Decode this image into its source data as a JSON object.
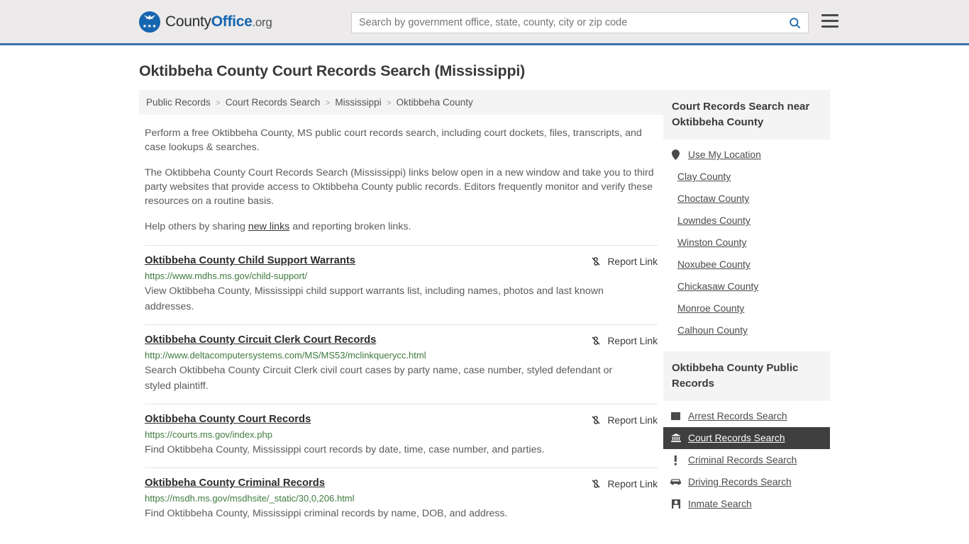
{
  "header": {
    "logo_text_1": "County",
    "logo_text_2": "Office",
    "logo_text_3": ".org",
    "logo_stars": "★★★",
    "search_placeholder": "Search by government office, state, county, city or zip code",
    "search_value": "",
    "search_icon": "search-icon",
    "menu_icon": "hamburger-menu-icon",
    "accent_color": "#3b72a8",
    "logo_blue": "#1565b0"
  },
  "page": {
    "title": "Oktibbeha County Court Records Search (Mississippi)"
  },
  "breadcrumb": {
    "separator": ">",
    "items": [
      {
        "label": "Public Records"
      },
      {
        "label": "Court Records Search"
      },
      {
        "label": "Mississippi"
      },
      {
        "label": "Oktibbeha County"
      }
    ]
  },
  "intro": {
    "p1": "Perform a free Oktibbeha County, MS public court records search, including court dockets, files, transcripts, and case lookups & searches.",
    "p2": "The Oktibbeha County Court Records Search (Mississippi) links below open in a new window and take you to third party websites that provide access to Oktibbeha County public records. Editors frequently monitor and verify these resources on a routine basis.",
    "p3_before": "Help others by sharing ",
    "p3_link": "new links",
    "p3_after": " and reporting broken links."
  },
  "results": {
    "report_label": "Report Link",
    "report_icon": "broken-link-icon",
    "items": [
      {
        "title": "Oktibbeha County Child Support Warrants",
        "url": "https://www.mdhs.ms.gov/child-support/",
        "description": "View Oktibbeha County, Mississippi child support warrants list, including names, photos and last known addresses."
      },
      {
        "title": "Oktibbeha County Circuit Clerk Court Records",
        "url": "http://www.deltacomputersystems.com/MS/MS53/mclinkquerycc.html",
        "description": "Search Oktibbeha County Circuit Clerk civil court cases by party name, case number, styled defendant or styled plaintiff."
      },
      {
        "title": "Oktibbeha County Court Records",
        "url": "https://courts.ms.gov/index.php",
        "description": "Find Oktibbeha County, Mississippi court records by date, time, case number, and parties."
      },
      {
        "title": "Oktibbeha County Criminal Records",
        "url": "https://msdh.ms.gov/msdhsite/_static/30,0,206.html",
        "description": "Find Oktibbeha County, Mississippi criminal records by name, DOB, and address."
      }
    ]
  },
  "sidebar": {
    "nearby": {
      "heading": "Court Records Search near Oktibbeha County",
      "items": [
        {
          "label": "Use My Location",
          "icon": "map-pin-icon"
        },
        {
          "label": "Clay County",
          "icon": ""
        },
        {
          "label": "Choctaw County",
          "icon": ""
        },
        {
          "label": "Lowndes County",
          "icon": ""
        },
        {
          "label": "Winston County",
          "icon": ""
        },
        {
          "label": "Noxubee County",
          "icon": ""
        },
        {
          "label": "Chickasaw County",
          "icon": ""
        },
        {
          "label": "Monroe County",
          "icon": ""
        },
        {
          "label": "Calhoun County",
          "icon": ""
        }
      ]
    },
    "public_records": {
      "heading": "Oktibbeha County Public Records",
      "active_index": 1,
      "items": [
        {
          "label": "Arrest Records Search",
          "icon": "fingerprint-icon"
        },
        {
          "label": "Court Records Search",
          "icon": "courthouse-icon"
        },
        {
          "label": "Criminal Records Search",
          "icon": "exclamation-icon"
        },
        {
          "label": "Driving Records Search",
          "icon": "car-icon"
        },
        {
          "label": "Inmate Search",
          "icon": "inmate-icon"
        }
      ]
    }
  }
}
